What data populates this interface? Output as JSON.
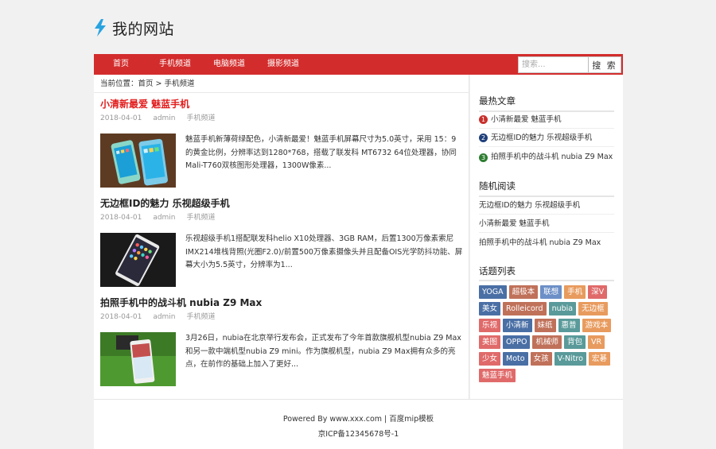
{
  "site": {
    "title": "我的网站"
  },
  "nav": {
    "items": [
      "首页",
      "手机频道",
      "电脑频道",
      "摄影频道"
    ]
  },
  "search": {
    "placeholder": "搜索...",
    "button": "搜 索"
  },
  "breadcrumb": {
    "prefix": "当前位置：",
    "home": "首页",
    "separator": " > ",
    "current": "手机频道"
  },
  "posts": [
    {
      "title": "小清新最爱 魅蓝手机",
      "date": "2018-04-01",
      "author": "admin",
      "category": "手机频道",
      "excerpt": "魅蓝手机新薄荷绿配色，小清新最爱！魅蓝手机屏幕尺寸为5.0英寸，采用 15：9 的黄金比例，分辨率达到1280*768，搭载了联发科 MT6732 64位处理器，协同Mali-T760双核图形处理器，1300W像素..."
    },
    {
      "title": "无边框ID的魅力 乐视超级手机",
      "date": "2018-04-01",
      "author": "admin",
      "category": "手机频道",
      "excerpt": "乐视超级手机1搭配联发科helio X10处理器、3GB RAM，后置1300万像素索尼IMX214堆栈背照(光圈F2.0)/前置500万像素摄像头并且配备OIS光学防抖功能、屏幕大小为5.5英寸，分辨率为1..."
    },
    {
      "title": "拍照手机中的战斗机 nubia Z9 Max",
      "date": "2018-04-01",
      "author": "admin",
      "category": "手机频道",
      "excerpt": "3月26日，nubia在北京举行发布会，正式发布了今年首款旗舰机型nubia Z9 Max和另一款中端机型nubia Z9 mini。作为旗舰机型，nubia Z9 Max拥有众多的亮点，在前作的基础上加入了更好..."
    }
  ],
  "sidebar": {
    "hot_title": "最热文章",
    "hot": [
      {
        "rank": "1",
        "title": "小清新最爱 魅蓝手机",
        "color": "#c9302c"
      },
      {
        "rank": "2",
        "title": "无边框ID的魅力 乐视超级手机",
        "color": "#1f3f7a"
      },
      {
        "rank": "3",
        "title": "拍照手机中的战斗机 nubia Z9 Max",
        "color": "#2e7d32"
      }
    ],
    "random_title": "随机阅读",
    "random": [
      "无边框ID的魅力 乐视超级手机",
      "小清新最爱 魅蓝手机",
      "拍照手机中的战斗机 nubia Z9 Max"
    ],
    "tags_title": "话题列表",
    "tags": [
      {
        "label": "YOGA",
        "color": "#4a6fa5"
      },
      {
        "label": "超极本",
        "color": "#c0715a"
      },
      {
        "label": "联想",
        "color": "#6c8fc7"
      },
      {
        "label": "手机",
        "color": "#e89b5e"
      },
      {
        "label": "深V",
        "color": "#e06a6a"
      },
      {
        "label": "美女",
        "color": "#4a6fa5"
      },
      {
        "label": "Rolleicord",
        "color": "#c0715a"
      },
      {
        "label": "nubia",
        "color": "#5a9a9a"
      },
      {
        "label": "无边框",
        "color": "#e89b5e"
      },
      {
        "label": "乐视",
        "color": "#e06a6a"
      },
      {
        "label": "小清新",
        "color": "#4a6fa5"
      },
      {
        "label": "妹纸",
        "color": "#c0715a"
      },
      {
        "label": "惠普",
        "color": "#5a9a9a"
      },
      {
        "label": "游戏本",
        "color": "#e89b5e"
      },
      {
        "label": "美图",
        "color": "#e06a6a"
      },
      {
        "label": "OPPO",
        "color": "#4a6fa5"
      },
      {
        "label": "机械师",
        "color": "#c0715a"
      },
      {
        "label": "背包",
        "color": "#5a9a9a"
      },
      {
        "label": "VR",
        "color": "#e89b5e"
      },
      {
        "label": "少女",
        "color": "#e06a6a"
      },
      {
        "label": "Moto",
        "color": "#4a6fa5"
      },
      {
        "label": "女孩",
        "color": "#c0715a"
      },
      {
        "label": "V-Nitro",
        "color": "#5a9a9a"
      },
      {
        "label": "宏碁",
        "color": "#e89b5e"
      },
      {
        "label": "魅蓝手机",
        "color": "#e06a6a"
      }
    ]
  },
  "footer": {
    "line1": "Powered By www.xxx.com | 百度mip模板",
    "line2": "京ICP备12345678号-1"
  },
  "colors": {
    "nav": "#d32c2c",
    "accent_title": "#e21b1b"
  }
}
